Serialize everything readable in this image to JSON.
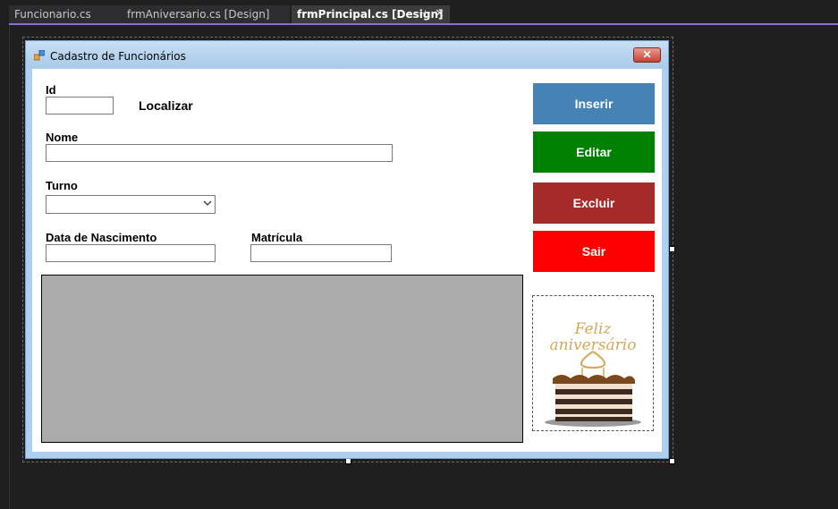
{
  "tabs": [
    {
      "label": "Funcionario.cs"
    },
    {
      "label": "frmAniversario.cs [Design]"
    },
    {
      "label": "frmPrincipal.cs [Design]",
      "active": true
    }
  ],
  "form": {
    "title": "Cadastro de Funcionários",
    "labels": {
      "id": "Id",
      "localizar": "Localizar",
      "nome": "Nome",
      "turno": "Turno",
      "nascimento": "Data de Nascimento",
      "matricula": "Matrícula"
    },
    "fields": {
      "id": "",
      "nome": "",
      "turno": "",
      "nascimento": "",
      "matricula": ""
    },
    "buttons": {
      "inserir": "Inserir",
      "editar": "Editar",
      "excluir": "Excluir",
      "sair": "Sair"
    },
    "picture": {
      "line1": "Feliz",
      "line2": "aniversário"
    }
  },
  "colors": {
    "inserir": "#4682B4",
    "editar": "#008000",
    "excluir": "#A52A2A",
    "sair": "#FF0000",
    "accent": "#8A70D6"
  },
  "icons": [
    "pin-icon",
    "close-icon",
    "form-app-icon",
    "dropdown-arrow-icon",
    "window-close-icon"
  ]
}
